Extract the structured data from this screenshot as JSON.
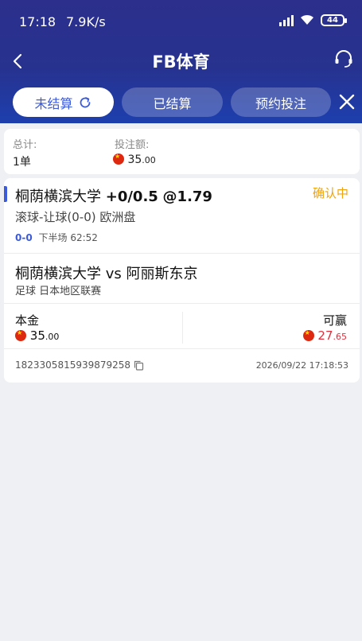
{
  "status_bar": {
    "time": "17:18",
    "speed": "7.9K/s",
    "battery": "44"
  },
  "nav": {
    "title": "FB体育",
    "back_icon": "chevron-left-icon",
    "support_icon": "headset-icon"
  },
  "tabs": [
    {
      "label": "未结算",
      "active": true,
      "icon": "refresh-icon"
    },
    {
      "label": "已结算",
      "active": false
    },
    {
      "label": "预约投注",
      "active": false
    }
  ],
  "summary": {
    "total_label": "总计:",
    "total_value": "1单",
    "amount_label": "投注额:",
    "amount_int": "35",
    "amount_dec": ".00"
  },
  "bet": {
    "team": "桐荫横滨大学",
    "handicap": "+0/0.5",
    "odds": "@1.79",
    "status": "确认中",
    "type": "滚球-让球(0-0) 欧洲盘",
    "score": "0-0",
    "period": "下半场 62:52",
    "match": "桐荫横滨大学 vs 阿丽斯东京",
    "league": "足球   日本地区联赛",
    "principal_label": "本金",
    "principal_int": "35",
    "principal_dec": ".00",
    "win_label": "可赢",
    "win_int": "27",
    "win_dec": ".65",
    "order_no": "1823305815939879258",
    "time": "2026/09/22 17:18:53"
  },
  "colors": {
    "header_dark": "#2c2f8c",
    "accent_blue": "#3b5bdb",
    "status_orange": "#f0a30a",
    "win_red": "#d9323e"
  }
}
